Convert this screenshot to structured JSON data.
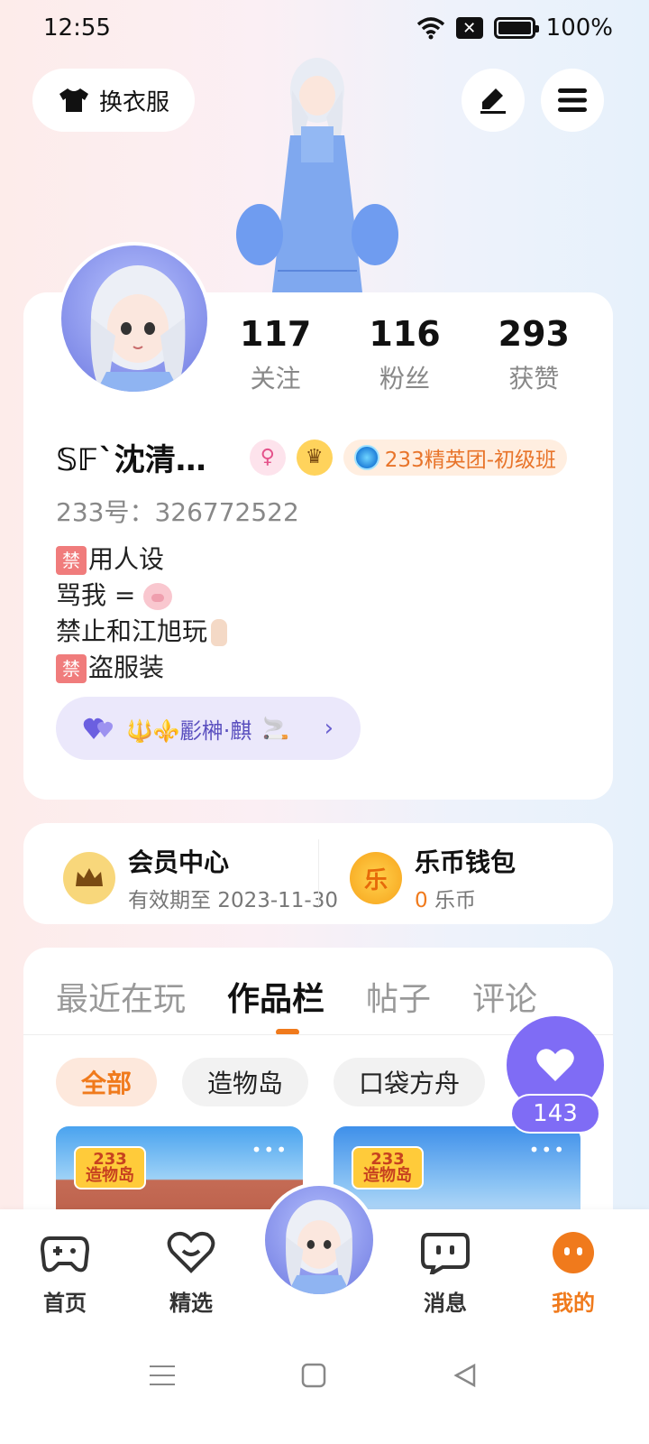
{
  "status": {
    "time": "12:55",
    "battery": "100%"
  },
  "header": {
    "outfit_label": "换衣服"
  },
  "profile": {
    "stats": [
      {
        "value": "117",
        "label": "关注"
      },
      {
        "value": "116",
        "label": "粉丝"
      },
      {
        "value": "293",
        "label": "获赞"
      }
    ],
    "name": "𝕊𝔽`沈清…",
    "badge_title": "233精英团-初级班",
    "uid": "233号：326772522",
    "bio": {
      "line1": "用人设",
      "line2": "骂我 = ",
      "line3": "禁止和江旭玩",
      "line4": "盗服装",
      "ban_char": "禁"
    },
    "bond_text": "🔱⚜️彲榊·麒",
    "bond_suffix": "🚬"
  },
  "vip": {
    "member": {
      "title": "会员中心",
      "sub": "有效期至 2023-11-30"
    },
    "wallet": {
      "title": "乐币钱包",
      "amount": "0",
      "unit": " 乐币",
      "icon_text": "乐"
    }
  },
  "works": {
    "tabs": [
      "最近在玩",
      "作品栏",
      "帖子",
      "评论"
    ],
    "chips": [
      "全部",
      "造物岛",
      "口袋方舟"
    ],
    "thumb_logo_top": "233",
    "thumb_logo_bottom": "造物岛"
  },
  "likes": {
    "count": "143"
  },
  "nav": [
    "首页",
    "精选",
    "消息",
    "我的"
  ],
  "colors": {
    "accent": "#f07a1c",
    "purple": "#7f6cf5"
  }
}
